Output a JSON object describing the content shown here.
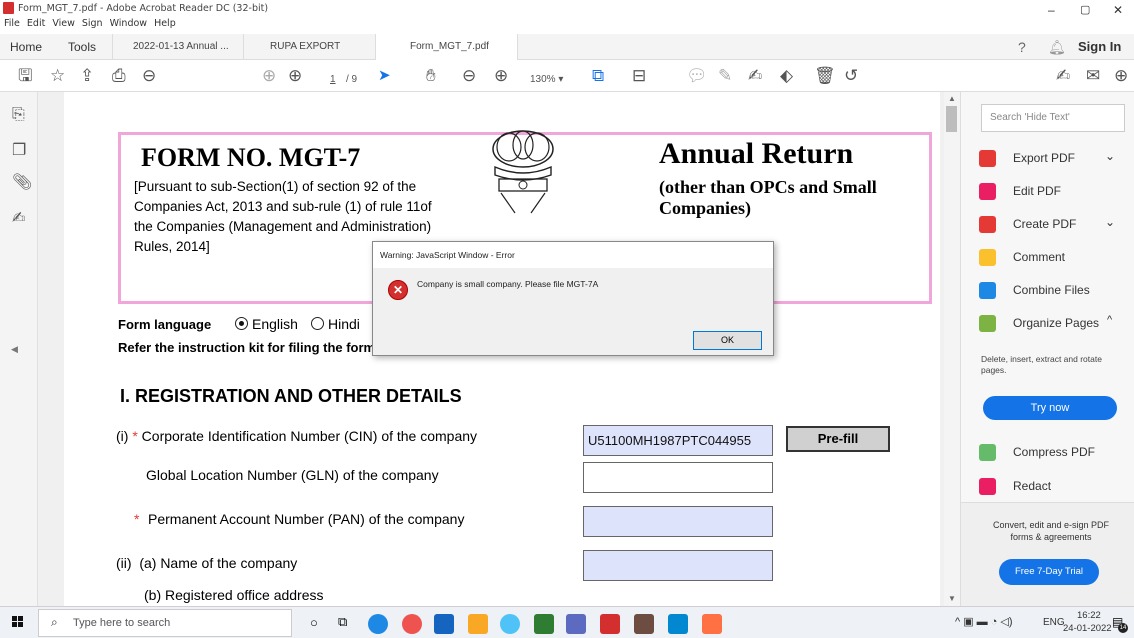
{
  "window": {
    "title": "Form_MGT_7.pdf - Adobe Acrobat Reader DC (32-bit)",
    "controls": [
      "–",
      "▢",
      "✕"
    ]
  },
  "menu": [
    "File",
    "Edit",
    "View",
    "Sign",
    "Window",
    "Help"
  ],
  "tabs": {
    "home": "Home",
    "tools": "Tools",
    "docs": [
      "2022-01-13 Annual ...",
      "RUPA EXPORT For...",
      "Form_MGT_7.pdf"
    ],
    "close": "×",
    "signin": "Sign In"
  },
  "toolbar": {
    "page_current": "1",
    "page_total": "/ 9",
    "zoom": "130%"
  },
  "form": {
    "form_no": "FORM NO. MGT-7",
    "pursuant": "[Pursuant to sub-Section(1) of section 92 of the Companies Act, 2013 and sub-rule (1) of rule 11of the Companies (Management and Administration) Rules, 2014]",
    "annual_return": "Annual Return",
    "subtitle": "(other than OPCs and Small Companies)",
    "form_language_label": "Form language",
    "lang_english": "English",
    "lang_hindi": "Hindi",
    "refer": "Refer the instruction kit for filing the form.",
    "section_title": "I. REGISTRATION AND OTHER DETAILS",
    "cin_prefix": "(i)",
    "star": "*",
    "cin_label": "Corporate Identification Number (CIN) of the company",
    "cin_value": "U51100MH1987PTC044955",
    "prefill": "Pre-fill",
    "gln_label": "Global Location Number (GLN) of the company",
    "pan_label": "Permanent Account Number (PAN) of the company",
    "name_label": "(ii)  (a) Name of the company",
    "address_label": "(b) Registered office address"
  },
  "dialog": {
    "title": "Warning: JavaScript Window - Error",
    "message": "Company is small company. Please file MGT-7A",
    "ok": "OK"
  },
  "rightpane": {
    "search_placeholder": "Search 'Hide Text'",
    "items": [
      "Export PDF",
      "Edit PDF",
      "Create PDF",
      "Comment",
      "Combine Files",
      "Organize Pages"
    ],
    "organize_desc": "Delete, insert, extract and rotate pages.",
    "try_now": "Try now",
    "items2": [
      "Compress PDF",
      "Redact"
    ],
    "promo": "Convert, edit and e-sign PDF forms & agreements",
    "trial": "Free 7-Day Trial",
    "colors": {
      "accent": "#1473e6"
    }
  },
  "taskbar": {
    "search_placeholder": "Type here to search",
    "lang": "ENG",
    "time": "16:22",
    "date": "24-01-2022",
    "notif_count": "14"
  }
}
